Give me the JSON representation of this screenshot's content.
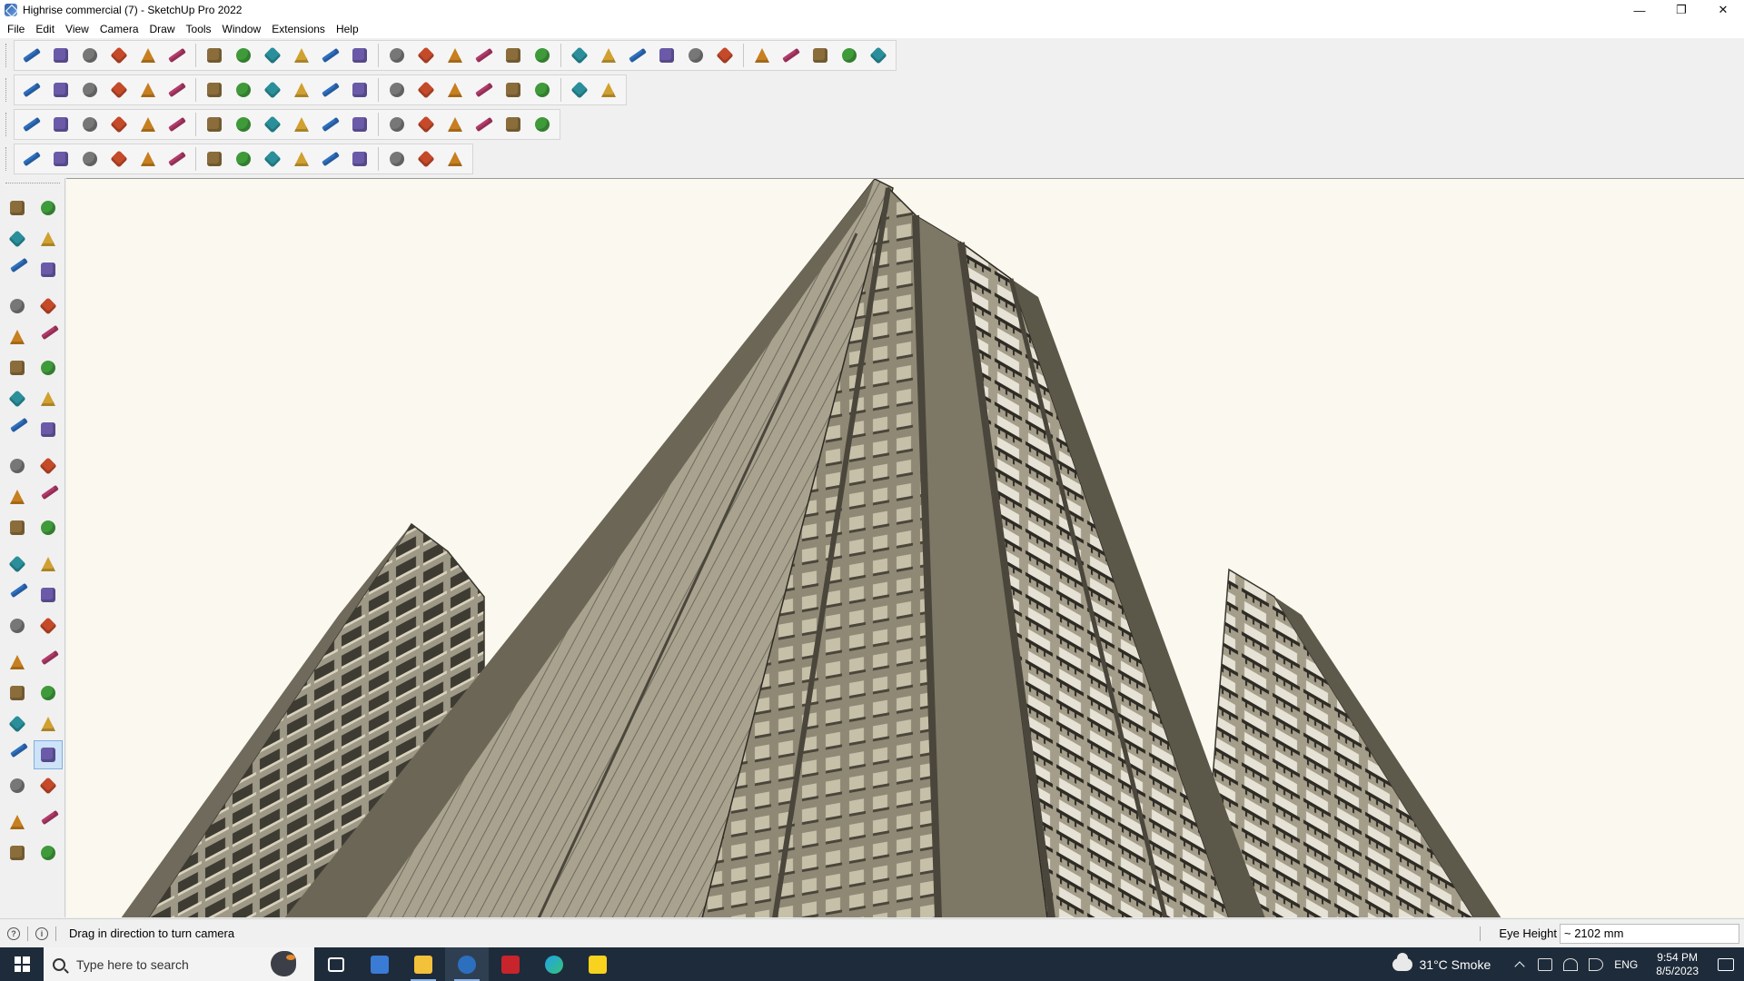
{
  "window": {
    "title": "Highrise commercial (7) - SketchUp Pro 2022",
    "minimize": "—",
    "restore": "❐",
    "close": "✕"
  },
  "menu": [
    "File",
    "Edit",
    "View",
    "Camera",
    "Draw",
    "Tools",
    "Window",
    "Extensions",
    "Help"
  ],
  "toolbars": {
    "row1": [
      "zoom-icon",
      "select-icon",
      "eraser-icon",
      "line-icon",
      "arc-icon",
      "rectangle-icon",
      "push-pull-icon",
      "follow-me-icon",
      "move-icon",
      "rotate-icon",
      "scale-icon",
      "tape-measure-icon",
      "text-icon",
      "paint-bucket-icon",
      "orbit-icon",
      "pan-icon",
      "zoom-window-icon",
      "zoom-extents-icon",
      "styles-icon",
      "xray-icon",
      "layers-icon",
      "shadows-icon",
      "components-icon",
      "section-icon",
      "sandbox-icon",
      "reverse-faces-icon",
      "undo-icon",
      "redo-icon",
      "warehouse-icon"
    ],
    "row2": [
      "box-icon",
      "sphere-icon",
      "cylinder-icon",
      "extrude-icon",
      "ruby-icon",
      "solid-icon",
      "house-icon",
      "roof-icon",
      "door-icon",
      "window-icon",
      "wall-icon",
      "stair-icon",
      "curve-icon",
      "ring-icon",
      "polygon-icon",
      "ellipse-icon",
      "spline-icon",
      "bezier-icon",
      "mirror-icon",
      "rail-icon"
    ],
    "row3": [
      "cube-blue-icon",
      "plane-icon",
      "surface-icon",
      "flat-icon",
      "arc-curl-icon",
      "frame-icon",
      "grid-icon",
      "node-icon",
      "cross-icon",
      "star-icon",
      "cone-icon",
      "pyramid-icon",
      "spiral-icon",
      "loop-icon",
      "weld-icon",
      "explode-icon",
      "tile-icon",
      "pattern-icon"
    ],
    "row4": [
      "dimension-icon",
      "polyline-icon",
      "offset-icon",
      "trim-icon",
      "fillet-icon",
      "chamfer-icon",
      "joint-icon",
      "extend-icon",
      "fence-icon",
      "railing-icon",
      "hatch-icon",
      "stair-run-icon",
      "glass-icon",
      "louver-icon",
      "deck-icon"
    ]
  },
  "left_toolbar": [
    [
      "select-icon",
      "orbit-icon"
    ],
    [
      "paint-icon",
      "eraser-icon"
    ],
    [
      "component-icon",
      "tag-icon"
    ],
    [
      "line-icon",
      "freehand-icon"
    ],
    [
      "rectangle-icon",
      "rotated-rectangle-icon"
    ],
    [
      "circle-icon",
      "polygon-icon"
    ],
    [
      "arc-icon",
      "two-point-arc-icon"
    ],
    [
      "three-point-arc-icon",
      "pie-icon"
    ],
    [
      "move-icon",
      "push-pull-icon"
    ],
    [
      "rotate-icon",
      "follow-me-icon"
    ],
    [
      "scale-icon",
      "offset-icon"
    ],
    [
      "tape-measure-icon",
      "dimension-icon"
    ],
    [
      "protractor-icon",
      "text-icon"
    ],
    [
      "axes-icon",
      "3d-text-icon"
    ],
    [
      "orbit-tool-icon",
      "pan-tool-icon"
    ],
    [
      "zoom-tool-icon",
      "zoom-window-tool-icon"
    ],
    [
      "zoom-extents-tool-icon",
      "previous-view-icon"
    ],
    [
      "position-camera-icon",
      "look-around-icon"
    ],
    [
      "walk-icon",
      "section-plane-icon"
    ],
    [
      "styles-panel-icon",
      "xray-panel-icon"
    ],
    [
      "layers-panel-icon",
      "shadows-panel-icon"
    ]
  ],
  "status": {
    "message": "Drag in direction to turn camera",
    "vcb_label": "Eye Height",
    "vcb_value": "~ 2102 mm"
  },
  "taskbar": {
    "search_placeholder": "Type here to search",
    "weather": "31°C  Smoke",
    "language": "ENG",
    "time": "9:54 PM",
    "date": "8/5/2023"
  },
  "colors": {
    "viewport_bg": "#fbf8ef",
    "facade": "#8f8a78",
    "facade_dark": "#5a5648",
    "taskbar_bg": "#1e2b3a"
  }
}
